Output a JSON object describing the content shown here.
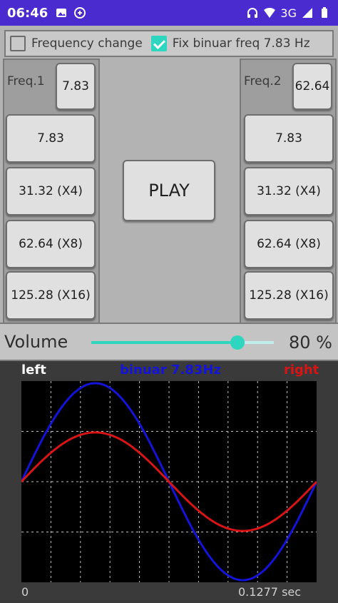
{
  "status": {
    "time": "06:46",
    "network": "3G"
  },
  "controls": {
    "freq_change_label": "Frequency change",
    "freq_change_checked": false,
    "fix_label": "Fix binuar freq 7.83 Hz",
    "fix_checked": true
  },
  "left": {
    "label": "Freq.1",
    "value": "7.83",
    "buttons": [
      "7.83",
      "31.32 (X4)",
      "62.64 (X8)",
      "125.28 (X16)"
    ]
  },
  "right": {
    "label": "Freq.2",
    "value": "62.64",
    "buttons": [
      "7.83",
      "31.32 (X4)",
      "62.64 (X8)",
      "125.28 (X16)"
    ]
  },
  "play_label": "PLAY",
  "volume": {
    "label": "Volume",
    "value": 80,
    "display": "80 %"
  },
  "scope": {
    "left_label": "left",
    "title": "binuar 7.83Hz",
    "right_label": "right",
    "x_start": "0",
    "x_end": "0.1277 sec",
    "colors": {
      "left": "#1414d8",
      "right": "#d81414",
      "title": "#1414d8",
      "grid": "#bdbdbd"
    },
    "left_amplitude": 1.0,
    "right_amplitude": 0.5,
    "cycles": 1
  }
}
